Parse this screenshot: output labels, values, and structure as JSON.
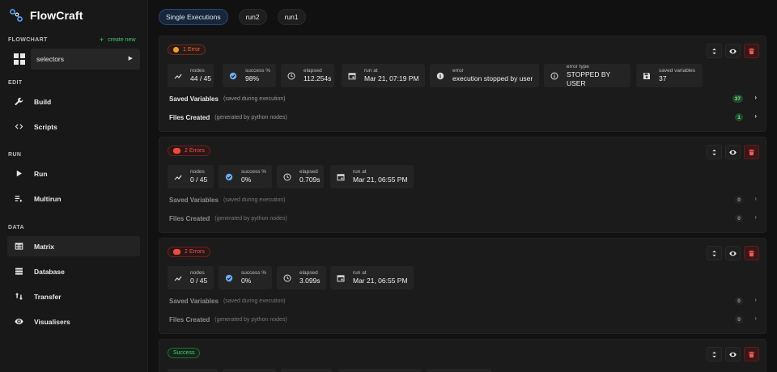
{
  "app": {
    "name": "FlowCraft"
  },
  "sidebar": {
    "flowchart_title": "FLOWCHART",
    "create_new": "create new",
    "flowchart_select": "selectors",
    "edit_title": "EDIT",
    "run_title": "RUN",
    "data_title": "DATA",
    "items": [
      {
        "label": "Build",
        "icon": "wrench-icon"
      },
      {
        "label": "Scripts",
        "icon": "code-icon"
      },
      {
        "label": "Run",
        "icon": "play-icon"
      },
      {
        "label": "Multirun",
        "icon": "list-play-icon"
      },
      {
        "label": "Matrix",
        "icon": "table-icon",
        "active": true
      },
      {
        "label": "Database",
        "icon": "database-icon"
      },
      {
        "label": "Transfer",
        "icon": "transfer-icon"
      },
      {
        "label": "Visualisers",
        "icon": "eye-icon"
      }
    ]
  },
  "tabs": [
    {
      "label": "Single Executions",
      "active": true
    },
    {
      "label": "run2"
    },
    {
      "label": "run1"
    }
  ],
  "colors": {
    "accent_green": "#3ec96a",
    "error_red": "#f05454",
    "error_orange": "#f06b4e",
    "active_tab": "#17263a"
  },
  "cards": [
    {
      "status": "1 Error",
      "stats": [
        {
          "label": "nodes",
          "value": "44 / 45",
          "icon": "trend-icon"
        },
        {
          "label": "success %",
          "value": "98%",
          "icon": "check-circle-icon"
        },
        {
          "label": "elapsed",
          "value": "112.254s",
          "icon": "clock-icon"
        },
        {
          "label": "run at",
          "value": "Mar 21, 07:19 PM",
          "icon": "calendar-icon"
        },
        {
          "label": "error",
          "value": "execution stopped by user",
          "icon": "info-icon"
        },
        {
          "label": "error type",
          "value": "STOPPED BY USER",
          "icon": "info-outline-icon"
        },
        {
          "label": "saved variables",
          "value": "37",
          "icon": "save-icon"
        }
      ],
      "saved_variables": {
        "label": "Saved Variables",
        "sub": "(saved during execution)",
        "count": "37"
      },
      "files_created": {
        "label": "Files Created",
        "sub": "(generated by python nodes)",
        "count": "1"
      }
    },
    {
      "status": "2 Errors",
      "stats": [
        {
          "label": "nodes",
          "value": "0 / 45",
          "icon": "trend-icon"
        },
        {
          "label": "success %",
          "value": "0%",
          "icon": "check-circle-icon"
        },
        {
          "label": "elapsed",
          "value": "0.709s",
          "icon": "clock-icon"
        },
        {
          "label": "run at",
          "value": "Mar 21, 06:55 PM",
          "icon": "calendar-icon"
        }
      ],
      "saved_variables": {
        "label": "Saved Variables",
        "sub": "(saved during execution)",
        "count": "0"
      },
      "files_created": {
        "label": "Files Created",
        "sub": "(generated by python nodes)",
        "count": "0"
      }
    },
    {
      "status": "2 Errors",
      "stats": [
        {
          "label": "nodes",
          "value": "0 / 45",
          "icon": "trend-icon"
        },
        {
          "label": "success %",
          "value": "0%",
          "icon": "check-circle-icon"
        },
        {
          "label": "elapsed",
          "value": "3.099s",
          "icon": "clock-icon"
        },
        {
          "label": "run at",
          "value": "Mar 21, 06:55 PM",
          "icon": "calendar-icon"
        }
      ],
      "saved_variables": {
        "label": "Saved Variables",
        "sub": "(saved during execution)",
        "count": "0"
      },
      "files_created": {
        "label": "Files Created",
        "sub": "(generated by python nodes)",
        "count": "0"
      }
    },
    {
      "status": "Success"
    }
  ]
}
